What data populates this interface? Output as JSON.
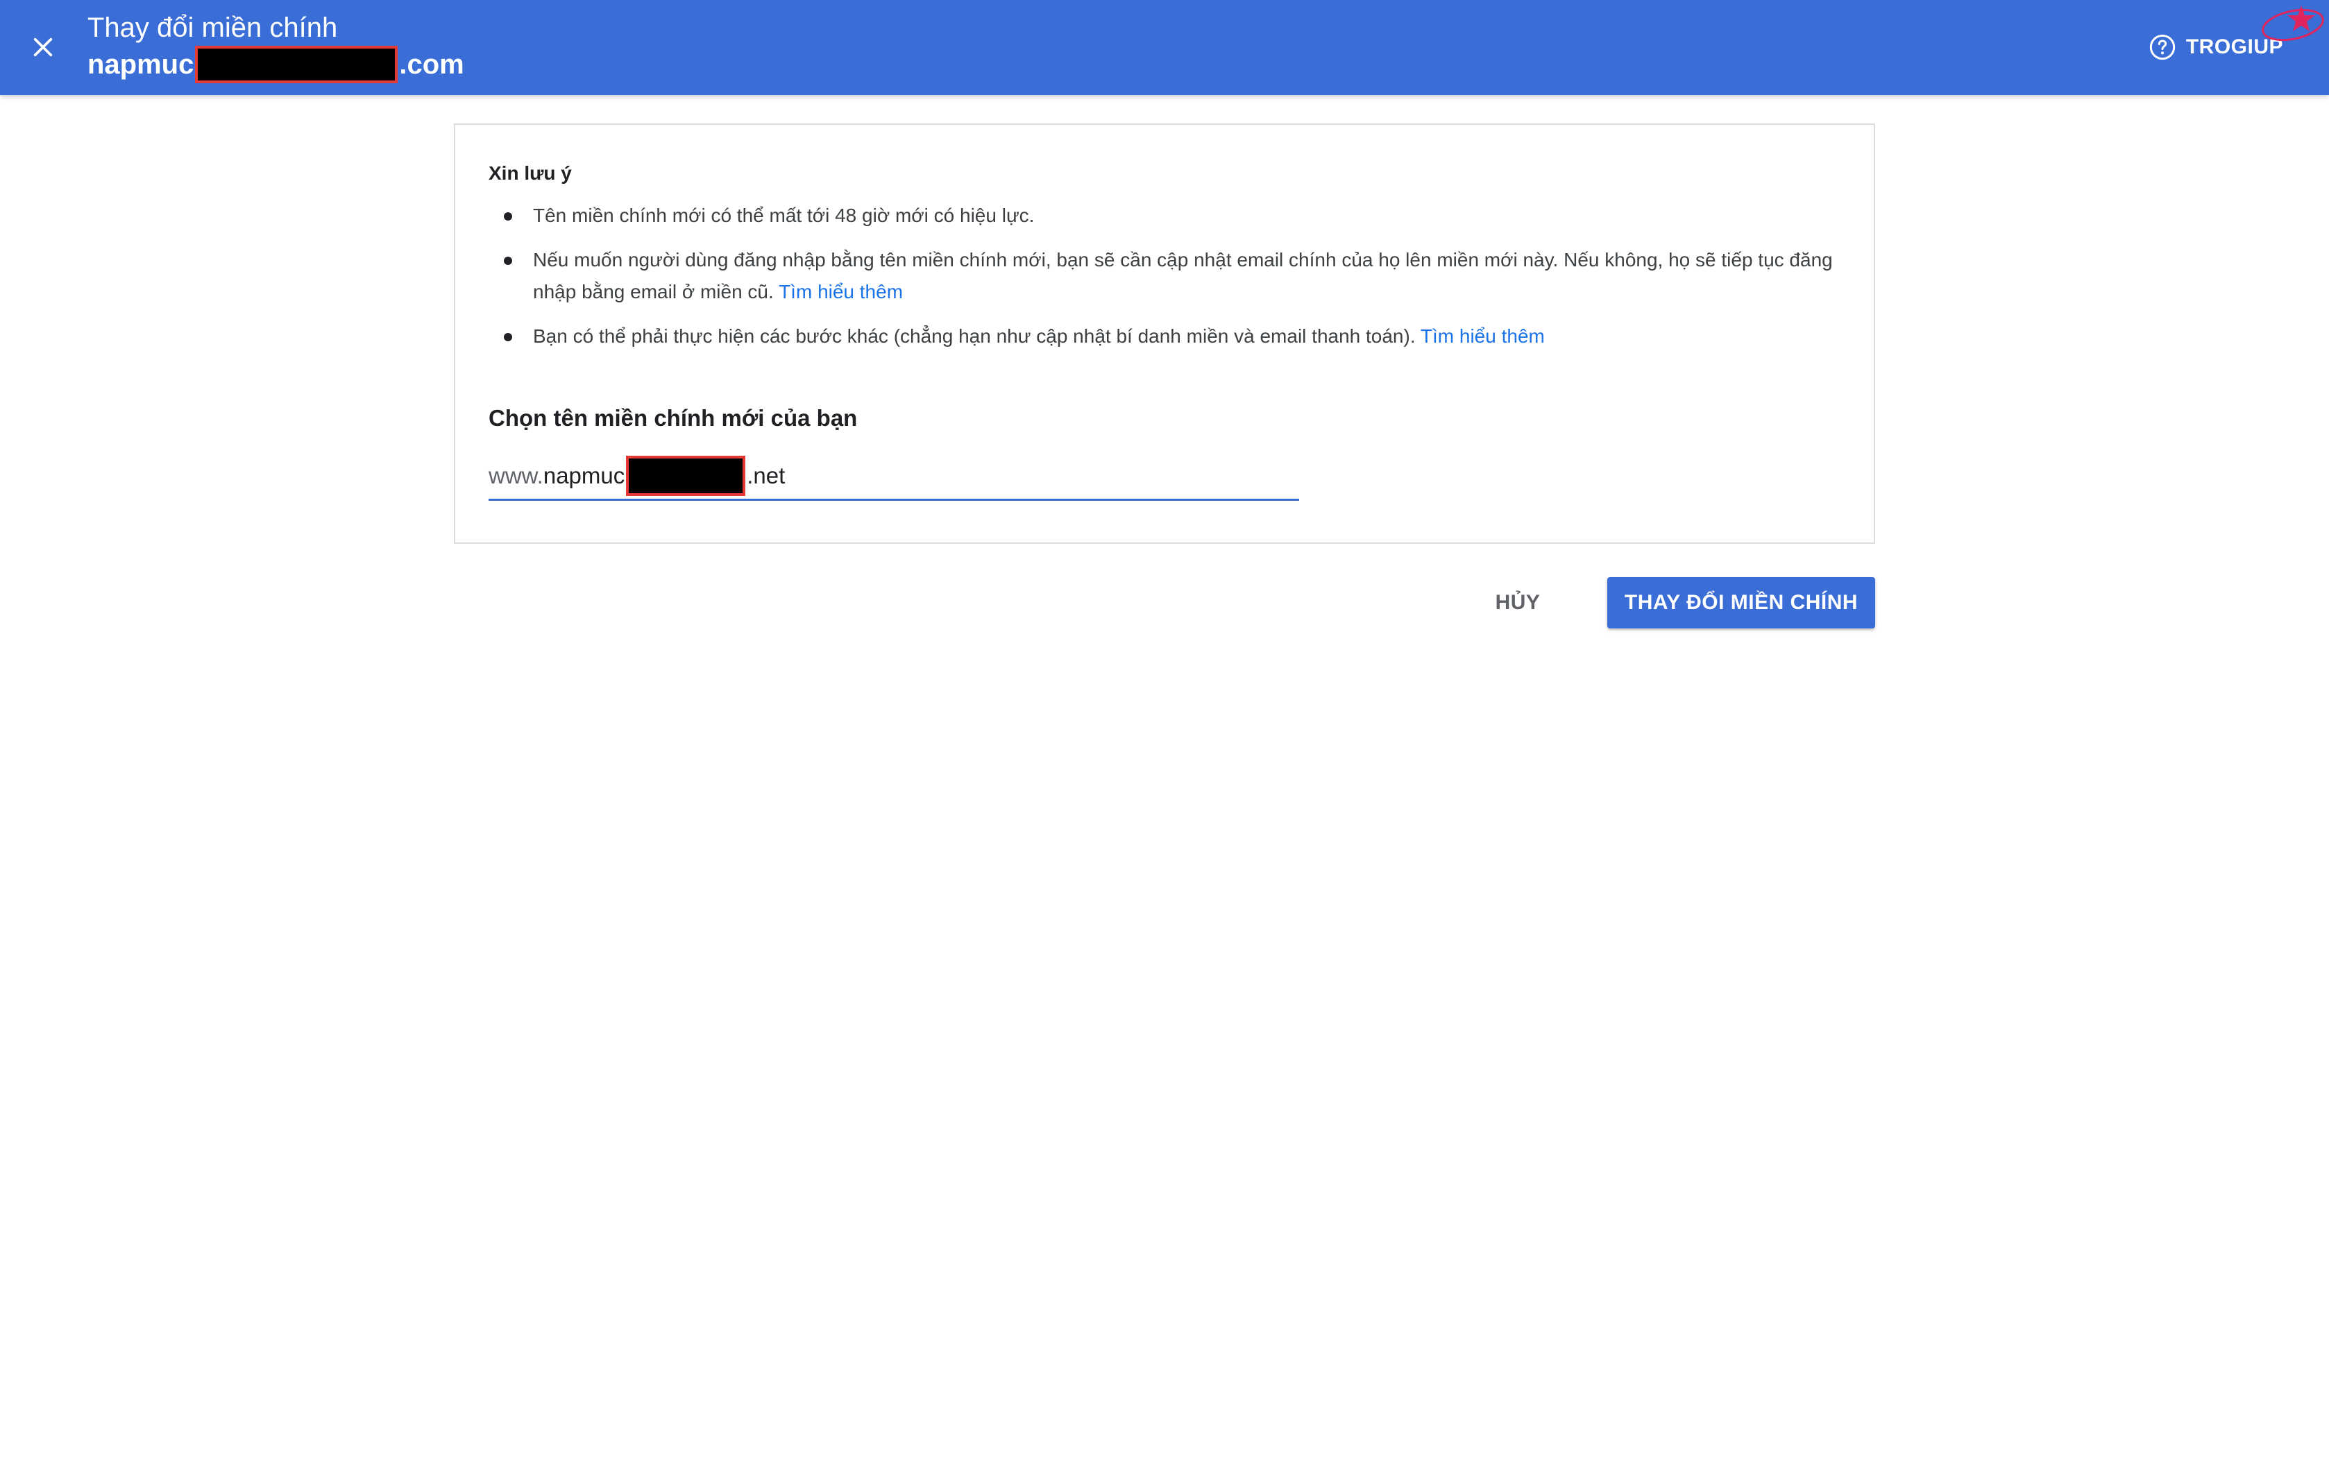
{
  "header": {
    "title": "Thay đổi miền chính",
    "domain_prefix": "napmuc",
    "domain_suffix": ".com",
    "help_label": "TROGIUP",
    "close_icon": "close-icon",
    "help_icon": "help-circle-icon",
    "background_color": "#3a6ed6"
  },
  "notice": {
    "title": "Xin lưu ý",
    "bullets": [
      {
        "text": "Tên miền chính mới có thể mất tới 48 giờ mới có hiệu lực.",
        "link": ""
      },
      {
        "text": "Nếu muốn người dùng đăng nhập bằng tên miền chính mới, bạn sẽ cần cập nhật email chính của họ lên miền mới này. Nếu không, họ sẽ tiếp tục đăng nhập bằng email ở miền cũ.",
        "link": "Tìm hiểu thêm"
      },
      {
        "text": "Bạn có thể phải thực hiện các bước khác (chẳng hạn như cập nhật bí danh miền và email thanh toán).",
        "link": "Tìm hiểu thêm"
      }
    ]
  },
  "domain_select": {
    "title": "Chọn tên miền chính mới của bạn",
    "prefix": "www.",
    "value_start": "napmuc",
    "value_end": ".net"
  },
  "actions": {
    "cancel_label": "HỦY",
    "confirm_label": "THAY ĐỔI MIỀN CHÍNH",
    "accent_color": "#3a6ed6"
  }
}
